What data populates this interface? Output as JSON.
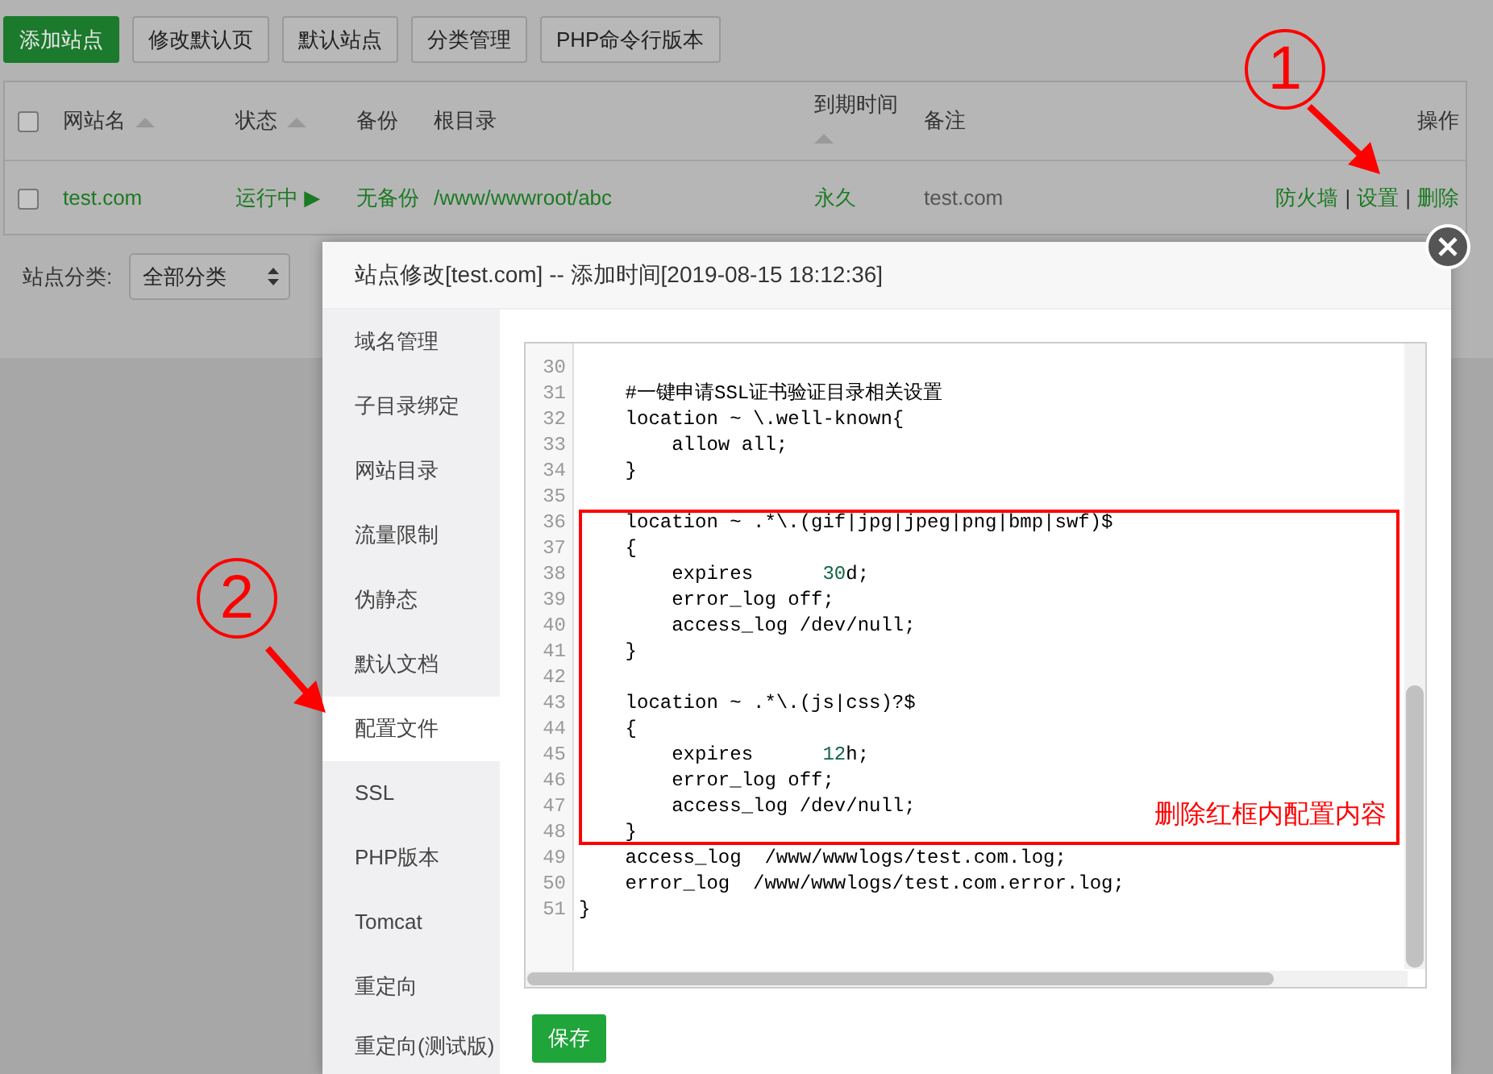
{
  "toolbar": {
    "buttons": [
      {
        "label": "添加站点",
        "kind": "primary"
      },
      {
        "label": "修改默认页",
        "kind": "default"
      },
      {
        "label": "默认站点",
        "kind": "default"
      },
      {
        "label": "分类管理",
        "kind": "default"
      },
      {
        "label": "PHP命令行版本",
        "kind": "default"
      }
    ]
  },
  "site_table": {
    "select_all": {
      "checked": false
    },
    "columns": [
      {
        "label": "网站名",
        "sortable": true
      },
      {
        "label": "状态",
        "sortable": true
      },
      {
        "label": "备份",
        "sortable": false
      },
      {
        "label": "根目录",
        "sortable": false
      },
      {
        "label": "到期时间",
        "sortable": true
      },
      {
        "label": "备注",
        "sortable": false
      },
      {
        "label": "操作",
        "sortable": false
      }
    ],
    "rows": [
      {
        "checked": false,
        "site": "test.com",
        "status": "运行中 ▶",
        "backup": "无备份",
        "root": "/www/wwwroot/abc",
        "expiry": "永久",
        "note": "test.com",
        "actions": [
          "防火墙",
          "设置",
          "删除"
        ],
        "separator": "|"
      }
    ]
  },
  "filter": {
    "label": "站点分类:",
    "value": "全部分类"
  },
  "modal": {
    "title": "站点修改[test.com] -- 添加时间[2019-08-15 18:12:36]",
    "sidebar": [
      {
        "label": "域名管理",
        "selected": false
      },
      {
        "label": "子目录绑定",
        "selected": false
      },
      {
        "label": "网站目录",
        "selected": false
      },
      {
        "label": "流量限制",
        "selected": false
      },
      {
        "label": "伪静态",
        "selected": false
      },
      {
        "label": "默认文档",
        "selected": false
      },
      {
        "label": "配置文件",
        "selected": true
      },
      {
        "label": "SSL",
        "selected": false
      },
      {
        "label": "PHP版本",
        "selected": false
      },
      {
        "label": "Tomcat",
        "selected": false
      },
      {
        "label": "重定向",
        "selected": false
      },
      {
        "label": "重定向(测试版)",
        "selected": false
      }
    ],
    "editor": {
      "blocks": [
        {
          "boxed": false,
          "lines": [
            {
              "n": "30"
            },
            {
              "n": "31",
              "text": "    #一键申请SSL证书验证目录相关设置"
            },
            {
              "n": "32",
              "text": "    location ~ \\.well-known{"
            },
            {
              "n": "33",
              "text": "        allow all;"
            },
            {
              "n": "34",
              "text": "    }"
            },
            {
              "n": "35"
            }
          ]
        },
        {
          "boxed": true,
          "note": "删除红框内配置内容",
          "lines": [
            {
              "n": "36",
              "text": "    location ~ .*\\.(gif|jpg|jpeg|png|bmp|swf)$"
            },
            {
              "n": "37",
              "text": "    {"
            },
            {
              "n": "38",
              "segments": [
                {
                  "kind": "text",
                  "text": "        expires      "
                },
                {
                  "kind": "number",
                  "text": "30"
                },
                {
                  "kind": "text",
                  "text": "d;"
                }
              ]
            },
            {
              "n": "39",
              "text": "        error_log off;"
            },
            {
              "n": "40",
              "text": "        access_log /dev/null;"
            },
            {
              "n": "41",
              "text": "    }"
            },
            {
              "n": "42"
            },
            {
              "n": "43",
              "text": "    location ~ .*\\.(js|css)?$"
            },
            {
              "n": "44",
              "text": "    {"
            },
            {
              "n": "45",
              "segments": [
                {
                  "kind": "text",
                  "text": "        expires      "
                },
                {
                  "kind": "number",
                  "text": "12"
                },
                {
                  "kind": "text",
                  "text": "h;"
                }
              ]
            },
            {
              "n": "46",
              "text": "        error_log off;"
            },
            {
              "n": "47",
              "text": "        access_log /dev/null;"
            },
            {
              "n": "48",
              "text": "    }"
            }
          ]
        },
        {
          "boxed": false,
          "lines": [
            {
              "n": "49",
              "text": "    access_log  /www/wwwlogs/test.com.log;"
            },
            {
              "n": "50",
              "text": "    error_log  /www/wwwlogs/test.com.error.log;"
            },
            {
              "n": "51",
              "text": "}"
            }
          ]
        }
      ]
    },
    "save_button": "保存"
  },
  "annotations": [
    {
      "kind": "step",
      "number": "1"
    },
    {
      "kind": "step",
      "number": "2"
    }
  ]
}
